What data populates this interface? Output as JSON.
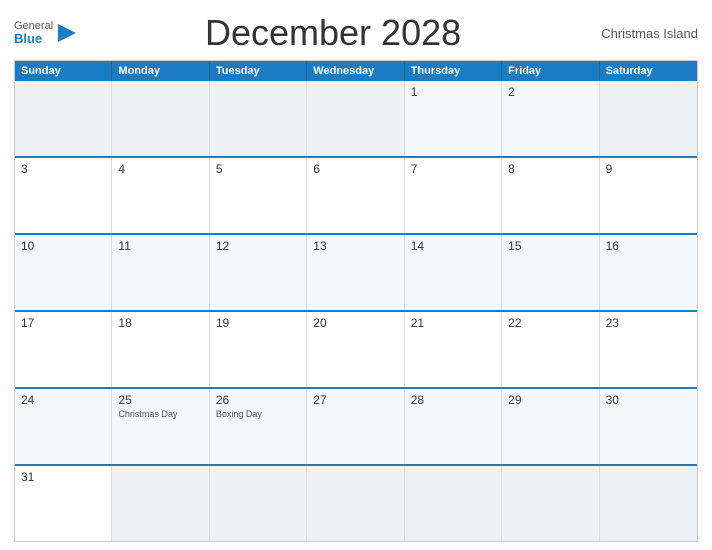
{
  "header": {
    "logo_general": "General",
    "logo_blue": "Blue",
    "title": "December 2028",
    "location": "Christmas Island"
  },
  "calendar": {
    "day_headers": [
      "Sunday",
      "Monday",
      "Tuesday",
      "Wednesday",
      "Thursday",
      "Friday",
      "Saturday"
    ],
    "weeks": [
      [
        {
          "num": "",
          "empty": true
        },
        {
          "num": "",
          "empty": true
        },
        {
          "num": "",
          "empty": true
        },
        {
          "num": "",
          "empty": true
        },
        {
          "num": "1"
        },
        {
          "num": "2"
        },
        {
          "num": "",
          "empty": true
        }
      ],
      [
        {
          "num": "3"
        },
        {
          "num": "4"
        },
        {
          "num": "5"
        },
        {
          "num": "6"
        },
        {
          "num": "7"
        },
        {
          "num": "8"
        },
        {
          "num": "9"
        }
      ],
      [
        {
          "num": "10"
        },
        {
          "num": "11"
        },
        {
          "num": "12"
        },
        {
          "num": "13"
        },
        {
          "num": "14"
        },
        {
          "num": "15"
        },
        {
          "num": "16"
        }
      ],
      [
        {
          "num": "17"
        },
        {
          "num": "18"
        },
        {
          "num": "19"
        },
        {
          "num": "20"
        },
        {
          "num": "21"
        },
        {
          "num": "22"
        },
        {
          "num": "23"
        }
      ],
      [
        {
          "num": "24"
        },
        {
          "num": "25",
          "event": "Christmas Day"
        },
        {
          "num": "26",
          "event": "Boxing Day"
        },
        {
          "num": "27"
        },
        {
          "num": "28"
        },
        {
          "num": "29"
        },
        {
          "num": "30"
        }
      ],
      [
        {
          "num": "31"
        },
        {
          "num": "",
          "empty": true
        },
        {
          "num": "",
          "empty": true
        },
        {
          "num": "",
          "empty": true
        },
        {
          "num": "",
          "empty": true
        },
        {
          "num": "",
          "empty": true
        },
        {
          "num": "",
          "empty": true
        }
      ]
    ]
  }
}
